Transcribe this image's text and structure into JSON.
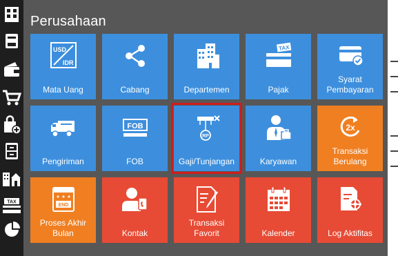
{
  "panel": {
    "title": "Perusahaan"
  },
  "sidebar": {
    "items": [
      {
        "icon": "building-icon"
      },
      {
        "icon": "book-icon"
      },
      {
        "icon": "wallet-icon"
      },
      {
        "icon": "cart-icon"
      },
      {
        "icon": "bag-add-icon"
      },
      {
        "icon": "cabinet-icon"
      },
      {
        "icon": "city-icon"
      },
      {
        "icon": "tax-icon"
      },
      {
        "icon": "pie-chart-icon"
      }
    ]
  },
  "tiles": [
    {
      "label": "Mata Uang",
      "icon": "currency-icon",
      "color": "#3d8fdd"
    },
    {
      "label": "Cabang",
      "icon": "share-icon",
      "color": "#3d8fdd"
    },
    {
      "label": "Departemen",
      "icon": "buildings-icon",
      "color": "#3d8fdd"
    },
    {
      "label": "Pajak",
      "icon": "tax-tag-icon",
      "color": "#3d8fdd"
    },
    {
      "label": "Syarat Pembayaran",
      "icon": "card-check-icon",
      "color": "#3d8fdd"
    },
    {
      "label": "Pengiriman",
      "icon": "truck-icon",
      "color": "#3d8fdd"
    },
    {
      "label": "FOB",
      "icon": "fob-sign-icon",
      "color": "#3d8fdd"
    },
    {
      "label": "Gaji/Tunjangan",
      "icon": "salary-icon",
      "color": "#3d8fdd",
      "selected": true
    },
    {
      "label": "Karyawan",
      "icon": "employee-icon",
      "color": "#3d8fdd"
    },
    {
      "label": "Transaksi Berulang",
      "icon": "repeat-2x-icon",
      "color": "#f07f21"
    },
    {
      "label": "Proses Akhir Bulan",
      "icon": "month-end-icon",
      "color": "#f07f21"
    },
    {
      "label": "Kontak",
      "icon": "contact-icon",
      "color": "#e74b35"
    },
    {
      "label": "Transaksi Favorit",
      "icon": "favorite-note-icon",
      "color": "#e74b35"
    },
    {
      "label": "Kalender",
      "icon": "calendar-icon",
      "color": "#e74b35"
    },
    {
      "label": "Log Aktifitas",
      "icon": "activity-log-icon",
      "color": "#e74b35"
    }
  ],
  "icon_text": {
    "usd": "USD",
    "idr": "IDR",
    "tax": "TAX",
    "fob": "FOB",
    "rp": "RP",
    "two_x": "2x",
    "end": "END"
  }
}
